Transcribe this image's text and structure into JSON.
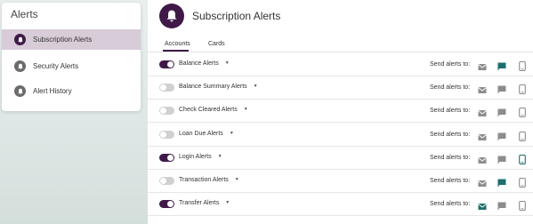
{
  "sidebar": {
    "title": "Alerts",
    "items": [
      {
        "label": "Subscription Alerts",
        "active": true
      },
      {
        "label": "Security Alerts",
        "active": false
      },
      {
        "label": "Alert History",
        "active": false
      }
    ]
  },
  "header": {
    "title": "Subscription Alerts"
  },
  "tabs": [
    {
      "label": "Accounts",
      "selected": true
    },
    {
      "label": "Cards",
      "selected": false
    }
  ],
  "send_label": "Send alerts to:",
  "icons": {
    "bell": "bell-icon",
    "toggle": "toggle-switch",
    "caret": "chevron-down-icon",
    "email": "email-icon",
    "push": "chat-icon",
    "phone": "phone-icon"
  },
  "colors": {
    "primary": "#3f1a47",
    "sidebar_active_bg": "#d8ccd9",
    "channel_on": "#1f6e6e",
    "channel_off": "#8c8c8c",
    "toggle_off": "#d0d0d0"
  },
  "alerts": [
    {
      "label": "Balance Alerts",
      "enabled": true,
      "email": false,
      "push": true,
      "phone": false
    },
    {
      "label": "Balance Summary Alerts",
      "enabled": false,
      "email": false,
      "push": false,
      "phone": false
    },
    {
      "label": "Check Cleared Alerts",
      "enabled": false,
      "email": false,
      "push": false,
      "phone": false
    },
    {
      "label": "Loan Due Alerts",
      "enabled": false,
      "email": false,
      "push": false,
      "phone": false
    },
    {
      "label": "Login Alerts",
      "enabled": true,
      "email": false,
      "push": false,
      "phone": true
    },
    {
      "label": "Transaction Alerts",
      "enabled": false,
      "email": false,
      "push": true,
      "phone": false
    },
    {
      "label": "Transfer Alerts",
      "enabled": true,
      "email": true,
      "push": false,
      "phone": false
    }
  ]
}
